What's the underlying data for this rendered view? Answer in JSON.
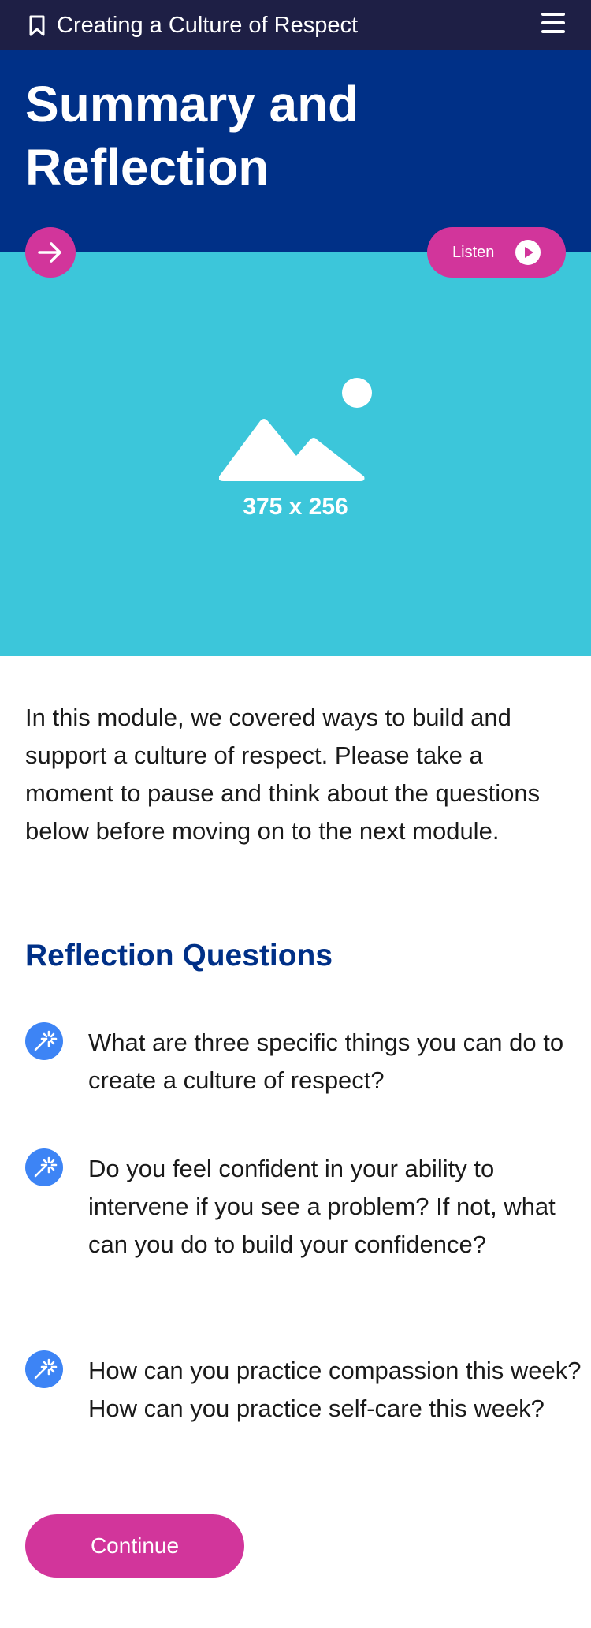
{
  "header": {
    "module_title": "Creating a Culture of Respect",
    "bookmark_icon": "bookmark-icon",
    "menu_icon": "hamburger-menu-icon"
  },
  "hero": {
    "title": "Summary and Reflection",
    "background": "#003087"
  },
  "controls": {
    "next_icon": "arrow-right-icon",
    "listen_label": "Listen",
    "listen_icon": "play-icon",
    "accent": "#d2359b"
  },
  "image_placeholder": {
    "icon": "image-placeholder-icon",
    "size_label": "375 x 256",
    "background": "#3cc6da"
  },
  "intro_text": "In this module, we covered ways to build and support a culture of respect. Please take a moment to pause and think about the questions below before moving on to the next module.",
  "reflection": {
    "title": "Reflection Questions",
    "icon": "magic-wand-icon",
    "questions": [
      "What are three specific things you can do to create a culture of respect?",
      "Do you feel confident in your ability to intervene if you see a problem? If not, what can you do to build your confidence?",
      "How can you practice compassion this week? How can you practice self-care this week?"
    ]
  },
  "continue_label": "Continue"
}
